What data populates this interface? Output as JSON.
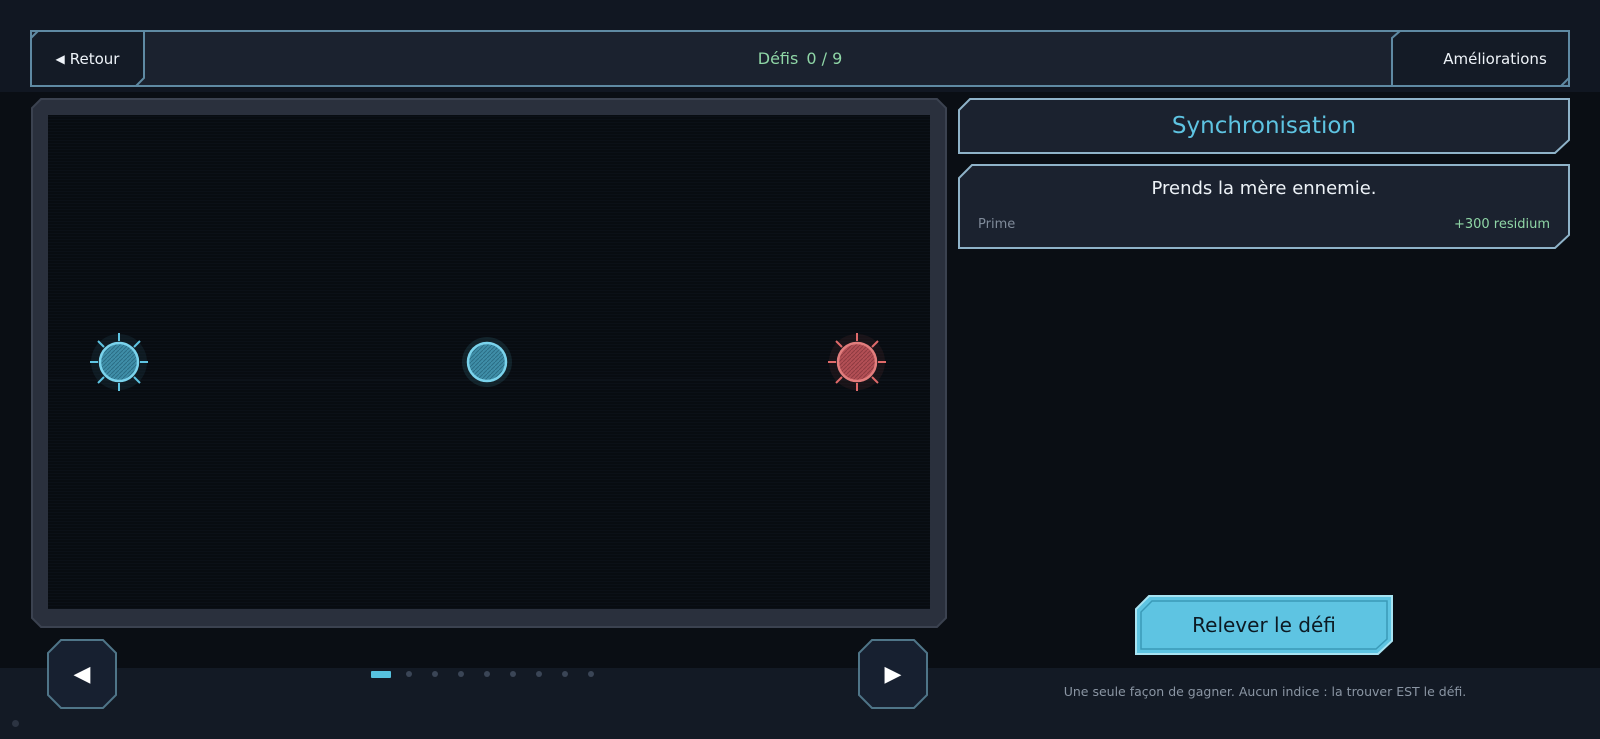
{
  "header": {
    "back_label": "Retour",
    "back_icon": "triangle-left-icon",
    "challenges_label": "Défis",
    "challenges_progress": "0 / 9",
    "upgrades_label": "Améliorations"
  },
  "board": {
    "units": [
      {
        "name": "player-mother",
        "team": "player",
        "type": "mother"
      },
      {
        "name": "neutral-cell",
        "team": "neutral",
        "type": "cell"
      },
      {
        "name": "enemy-mother",
        "team": "enemy",
        "type": "mother"
      }
    ]
  },
  "pager": {
    "prev_icon": "◀",
    "next_icon": "▶",
    "page_count": 9,
    "current_page": 1
  },
  "challenge": {
    "title": "Synchronisation",
    "objective": "Prends la mère ennemie.",
    "bounty_label": "Prime",
    "bounty_value": "+300 residium",
    "cta_label": "Relever le défi",
    "hint": "Une seule façon de gagner. Aucun indice : la trouver EST le défi."
  },
  "colors": {
    "accent": "#5ec4e2",
    "positive": "#8fd6a6",
    "player": "#5ec4e2",
    "enemy": "#e06a6a",
    "panel_border": "#8fb3c9"
  }
}
